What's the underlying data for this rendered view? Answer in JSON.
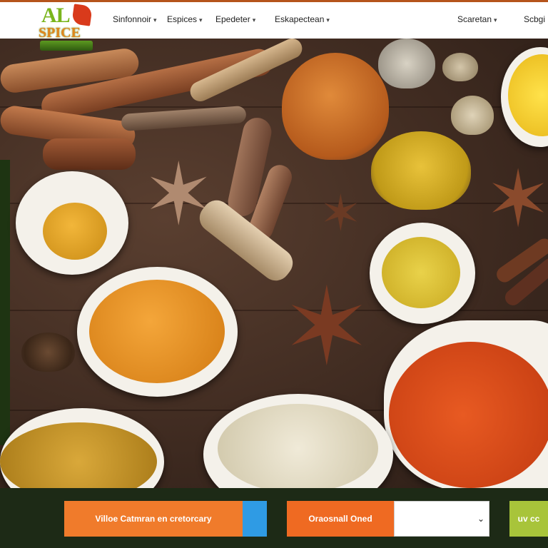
{
  "logo": {
    "line1": "AL",
    "line2": "SPICE"
  },
  "nav": {
    "items": [
      {
        "label": "Sinfonnoir"
      },
      {
        "label": "Espices"
      },
      {
        "label": "Epedeter"
      },
      {
        "label": "Eskapectean"
      },
      {
        "label": "Scaretan"
      },
      {
        "label": "Scbgi"
      }
    ],
    "caret": "▾"
  },
  "footer": {
    "left_button": "Villoe Catmran en cretorcary",
    "middle_button": "Oraosnall Oned",
    "select_caret": "⌄",
    "right_button": "uv cc"
  },
  "colors": {
    "accent_orange": "#f07b2b",
    "accent_blue": "#2f9be4",
    "accent_green": "#a8c43a",
    "footer_bg": "#1d2a16"
  },
  "icons": [
    "chevron-down-icon",
    "star-anise-icon"
  ]
}
